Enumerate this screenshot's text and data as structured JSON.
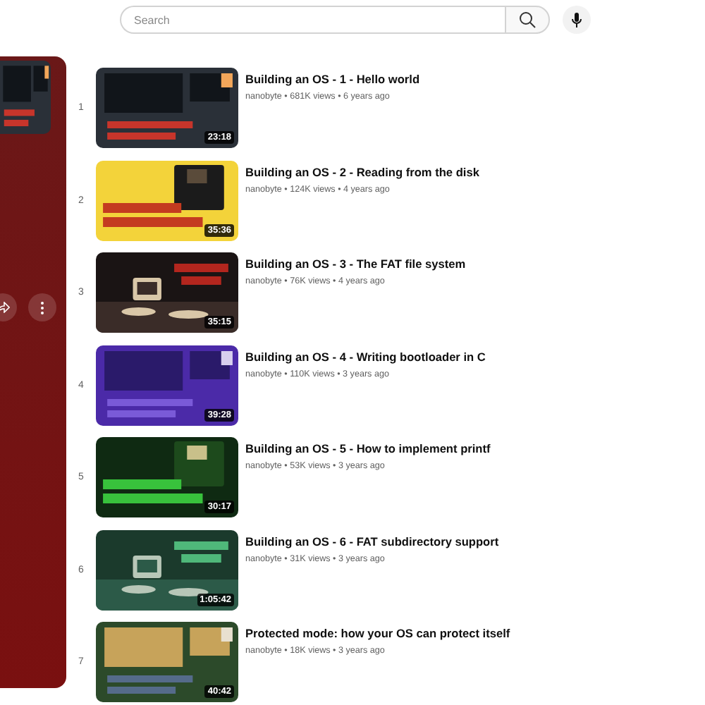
{
  "search": {
    "placeholder": "Search"
  },
  "videos": [
    {
      "index": "1",
      "title": "Building an OS - 1 - Hello world",
      "meta": "nanobyte • 681K views • 6 years ago",
      "duration": "23:18"
    },
    {
      "index": "2",
      "title": "Building an OS - 2 - Reading from the disk",
      "meta": "nanobyte • 124K views • 4 years ago",
      "duration": "35:36"
    },
    {
      "index": "3",
      "title": "Building an OS - 3 - The FAT file system",
      "meta": "nanobyte • 76K views • 4 years ago",
      "duration": "35:15"
    },
    {
      "index": "4",
      "title": "Building an OS - 4 - Writing bootloader in C",
      "meta": "nanobyte • 110K views • 3 years ago",
      "duration": "39:28"
    },
    {
      "index": "5",
      "title": "Building an OS - 5 - How to implement printf",
      "meta": "nanobyte • 53K views • 3 years ago",
      "duration": "30:17"
    },
    {
      "index": "6",
      "title": "Building an OS - 6 - FAT subdirectory support",
      "meta": "nanobyte • 31K views • 3 years ago",
      "duration": "1:05:42"
    },
    {
      "index": "7",
      "title": "Protected mode: how your OS can protect itself",
      "meta": "nanobyte • 18K views • 3 years ago",
      "duration": "40:42"
    }
  ]
}
